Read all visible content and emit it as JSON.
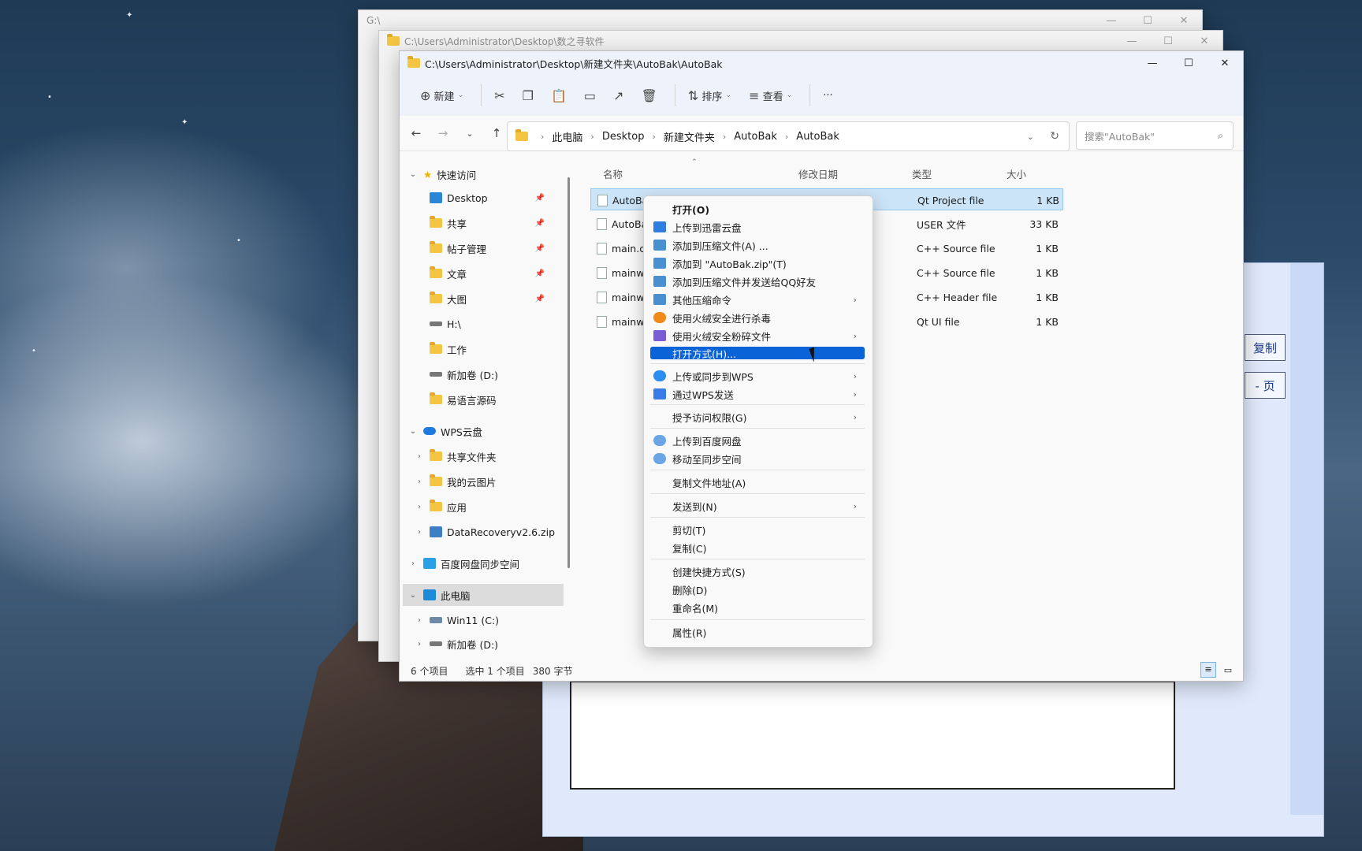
{
  "windows": {
    "back1": {
      "title": "G:\\",
      "controls": [
        "—",
        "☐",
        "✕"
      ]
    },
    "back2": {
      "title": "C:\\Users\\Administrator\\Desktop\\数之寻软件",
      "controls": [
        "—",
        "☐",
        "✕"
      ]
    }
  },
  "explorer": {
    "title": "C:\\Users\\Administrator\\Desktop\\新建文件夹\\AutoBak\\AutoBak",
    "toolbar": {
      "new_label": "新建",
      "sort_label": "排序",
      "view_label": "查看",
      "more": "···"
    },
    "breadcrumb": [
      "此电脑",
      "Desktop",
      "新建文件夹",
      "AutoBak",
      "AutoBak"
    ],
    "search_placeholder": "搜索\"AutoBak\"",
    "nav": {
      "quick_access": "快速访问",
      "items": [
        "Desktop",
        "共享",
        "帖子管理",
        "文章",
        "大图",
        "H:\\",
        "工作",
        "新加卷 (D:)",
        "易语言源码"
      ],
      "wps": "WPS云盘",
      "wps_items": [
        "共享文件夹",
        "我的云图片",
        "应用",
        "DataRecoveryv2.6.zip"
      ],
      "baidu": "百度网盘同步空间",
      "pc": "此电脑",
      "pc_items": [
        "Win11 (C:)",
        "新加卷 (D:)"
      ]
    },
    "columns": {
      "name": "名称",
      "date": "修改日期",
      "type": "类型",
      "size": "大小"
    },
    "files": [
      {
        "name": "AutoBak",
        "type": "Qt Project file",
        "size": "1 KB"
      },
      {
        "name": "AutoBak",
        "type": "USER 文件",
        "size": "33 KB"
      },
      {
        "name": "main.cp",
        "type": "C++ Source file",
        "size": "1 KB"
      },
      {
        "name": "mainwi",
        "type": "C++ Source file",
        "size": "1 KB"
      },
      {
        "name": "mainwi",
        "type": "C++ Header file",
        "size": "1 KB"
      },
      {
        "name": "mainwi",
        "type": "Qt UI file",
        "size": "1 KB"
      }
    ],
    "status": {
      "count": "6 个项目",
      "selected": "选中 1 个项目",
      "bytes": "380 字节"
    }
  },
  "context_menu": [
    {
      "label": "打开(O)"
    },
    {
      "label": "上传到迅雷云盘"
    },
    {
      "label": "添加到压缩文件(A) ..."
    },
    {
      "label": "添加到 \"AutoBak.zip\"(T)"
    },
    {
      "label": "添加到压缩文件并发送给QQ好友"
    },
    {
      "label": "其他压缩命令"
    },
    {
      "label": "使用火绒安全进行杀毒"
    },
    {
      "label": "使用火绒安全粉碎文件"
    },
    {
      "label": "打开方式(H)..."
    },
    {
      "label": "上传或同步到WPS"
    },
    {
      "label": "通过WPS发送"
    },
    {
      "label": "授予访问权限(G)"
    },
    {
      "label": "上传到百度网盘"
    },
    {
      "label": "移动至同步空间"
    },
    {
      "label": "复制文件地址(A)"
    },
    {
      "label": "发送到(N)"
    },
    {
      "label": "剪切(T)"
    },
    {
      "label": "复制(C)"
    },
    {
      "label": "创建快捷方式(S)"
    },
    {
      "label": "删除(D)"
    },
    {
      "label": "重命名(M)"
    },
    {
      "label": "属性(R)"
    }
  ],
  "dialog": {
    "copy_label": "复制",
    "page_label": "- 页"
  }
}
